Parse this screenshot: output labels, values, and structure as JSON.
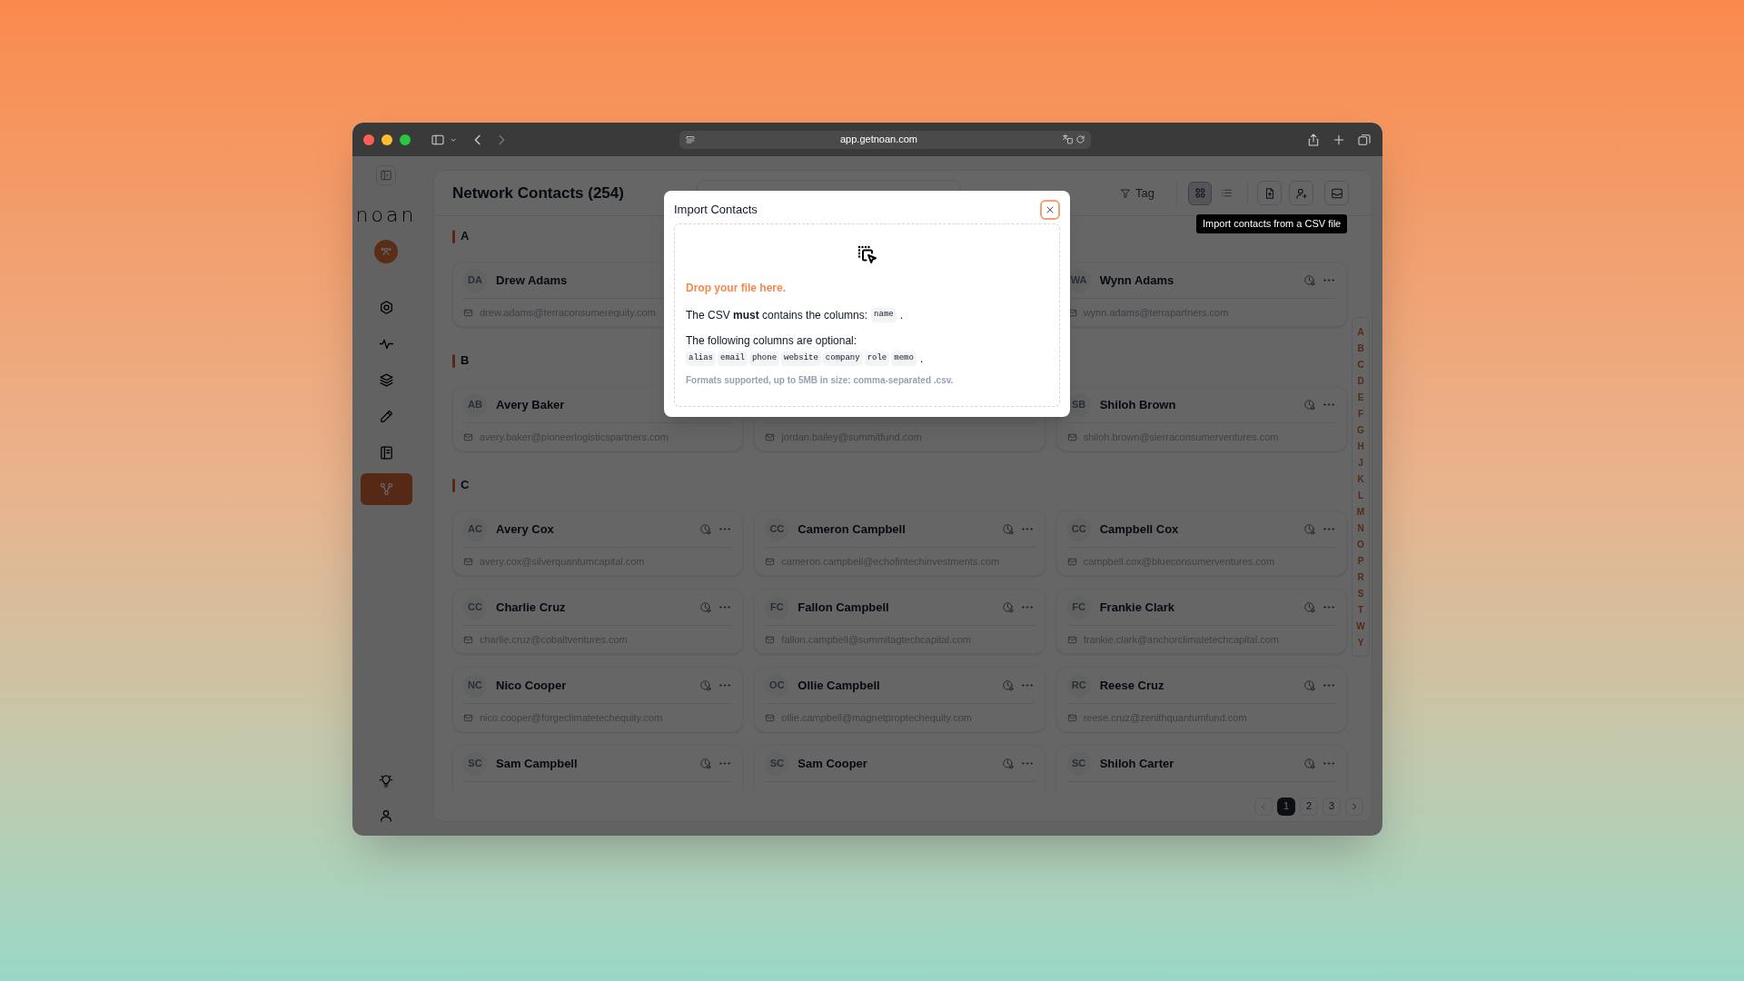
{
  "browser": {
    "url": "app.getnoan.com"
  },
  "sidebar": {
    "logo": "noan",
    "nav": [
      {
        "kind": "hexagon",
        "selected": false
      },
      {
        "kind": "activity",
        "selected": false
      },
      {
        "kind": "layers",
        "selected": false
      },
      {
        "kind": "pencil",
        "selected": false
      },
      {
        "kind": "book",
        "selected": false
      },
      {
        "kind": "network",
        "selected": true
      }
    ],
    "bottom": [
      {
        "kind": "bulb"
      },
      {
        "kind": "user"
      }
    ]
  },
  "header": {
    "title": "Network Contacts (254)",
    "tag_button": "Tag",
    "views": [
      {
        "kind": "grid",
        "selected": true
      },
      {
        "kind": "list",
        "selected": false
      }
    ]
  },
  "tooltip": "Import contacts from a CSV file",
  "sections": [
    {
      "letter": "A",
      "cards": [
        {
          "kind": "contact",
          "initials": "DA",
          "name": "Drew Adams",
          "email": "drew.adams@terraconsumerequity.com"
        },
        {
          "kind": "covered"
        },
        {
          "kind": "contact",
          "initials": "WA",
          "name": "Wynn Adams",
          "email": "wynn.adams@terrapartners.com",
          "actions": true
        }
      ]
    },
    {
      "letter": "B",
      "cards": [
        {
          "kind": "contact",
          "initials": "AB",
          "name": "Avery Baker",
          "email": "avery.baker@pioneerlogisticspartners.com"
        },
        {
          "kind": "contact",
          "email": "jordan.bailey@summitfund.com"
        },
        {
          "kind": "contact",
          "initials": "SB",
          "name": "Shiloh Brown",
          "email": "shiloh.brown@sierraconsumerventures.com",
          "actions": true
        }
      ]
    },
    {
      "letter": "C",
      "cards": [
        {
          "kind": "contact",
          "initials": "AC",
          "name": "Avery Cox",
          "email": "avery.cox@silverquantumcapital.com",
          "actions": true
        },
        {
          "kind": "contact",
          "initials": "CC",
          "name": "Cameron Campbell",
          "email": "cameron.campbell@echofintechinvestments.com",
          "actions": true
        },
        {
          "kind": "contact",
          "initials": "CC",
          "name": "Campbell Cox",
          "email": "campbell.cox@blueconsumerventures.com",
          "actions": true
        },
        {
          "kind": "contact",
          "initials": "CC",
          "name": "Charlie Cruz",
          "email": "charlie.cruz@cobaltventures.com",
          "actions": true
        },
        {
          "kind": "contact",
          "initials": "FC",
          "name": "Fallon Campbell",
          "email": "fallon.campbell@summitagtechcapital.com",
          "actions": true
        },
        {
          "kind": "contact",
          "initials": "FC",
          "name": "Frankie Clark",
          "email": "frankie.clark@anchorclimatetechcapital.com",
          "actions": true
        },
        {
          "kind": "contact",
          "initials": "NC",
          "name": "Nico Cooper",
          "email": "nico.cooper@forgeclimatetechequity.com",
          "actions": true
        },
        {
          "kind": "contact",
          "initials": "OC",
          "name": "Ollie Campbell",
          "email": "ollie.campbell@magnetproptechequity.com",
          "actions": true
        },
        {
          "kind": "contact",
          "initials": "RC",
          "name": "Reese Cruz",
          "email": "reese.cruz@zenithquantumfund.com",
          "actions": true
        },
        {
          "kind": "contact",
          "initials": "SC",
          "name": "Sam Campbell",
          "actions": true
        },
        {
          "kind": "contact",
          "initials": "SC",
          "name": "Sam Cooper",
          "actions": true
        },
        {
          "kind": "contact",
          "initials": "SC",
          "name": "Shiloh Carter",
          "actions": true
        }
      ]
    }
  ],
  "index": [
    "A",
    "B",
    "C",
    "D",
    "E",
    "F",
    "G",
    "H",
    "J",
    "K",
    "L",
    "M",
    "N",
    "O",
    "P",
    "R",
    "S",
    "T",
    "W",
    "Y"
  ],
  "pagination": {
    "pages": [
      {
        "label": "1",
        "selected": true
      },
      {
        "label": "2",
        "selected": false
      },
      {
        "label": "3",
        "selected": false
      }
    ]
  },
  "modal": {
    "title": "Import Contacts",
    "drop_text": "Drop your file here.",
    "required_text": "The CSV **must** contains the columns:",
    "required_columns": [
      "name"
    ],
    "required_end": ".",
    "optional_text": "The following columns are optional:",
    "optional_columns": [
      "alias",
      "email",
      "phone",
      "website",
      "company",
      "role",
      "memo"
    ],
    "optional_end": ".",
    "formats": "Formats supported, up to 5MB in size: comma-separated .csv."
  }
}
